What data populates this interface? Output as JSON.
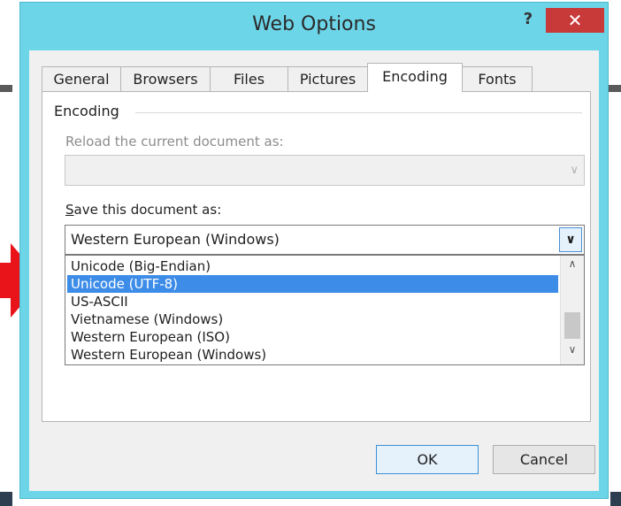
{
  "window": {
    "title": "Web Options",
    "help_label": "?",
    "close_label": "✕"
  },
  "tabs": [
    {
      "label": "General"
    },
    {
      "label": "Browsers"
    },
    {
      "label": "Files"
    },
    {
      "label": "Pictures"
    },
    {
      "label": "Encoding",
      "active": true
    },
    {
      "label": "Fonts"
    }
  ],
  "encoding": {
    "group_label": "Encoding",
    "reload_label": "Reload the current document as:",
    "reload_value": "",
    "save_label_first": "S",
    "save_label_rest": "ave this document as:",
    "save_value": "Western European (Windows)",
    "options": [
      "Unicode (Big-Endian)",
      "Unicode (UTF-8)",
      "US-ASCII",
      "Vietnamese (Windows)",
      "Western European (ISO)",
      "Western European (Windows)"
    ],
    "highlighted_option": "Unicode (UTF-8)"
  },
  "buttons": {
    "ok": "OK",
    "cancel": "Cancel"
  },
  "icons": {
    "dropdown": "chevron-down-icon",
    "scroll_up": "chevron-up-icon",
    "scroll_down": "chevron-down-icon",
    "pointer": "red-arrow-icon"
  },
  "colors": {
    "titlebar": "#6dd5e8",
    "close_button": "#c8393a",
    "selection": "#3d8ce8",
    "arrow": "#e8141a"
  }
}
